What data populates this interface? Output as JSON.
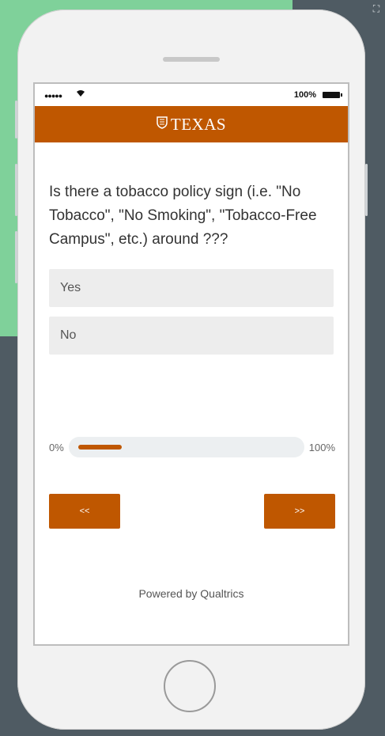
{
  "status": {
    "signal": "●●●●●",
    "wifi": "wifi-icon",
    "battery_pct": "100%"
  },
  "header": {
    "logo_icon": "shield-icon",
    "logo_text": "TEXAS",
    "color": "#bf5700"
  },
  "question": {
    "text": "Is there a tobacco policy sign (i.e. \"No Tobacco\", \"No Smoking\", \"Tobacco-Free Campus\", etc.) around ???"
  },
  "choices": [
    {
      "label": "Yes"
    },
    {
      "label": "No"
    }
  ],
  "progress": {
    "left_label": "0%",
    "right_label": "100%",
    "value": 0.2
  },
  "nav": {
    "back_label": "<<",
    "next_label": ">>"
  },
  "footer": {
    "powered_by": "Powered by Qualtrics"
  }
}
